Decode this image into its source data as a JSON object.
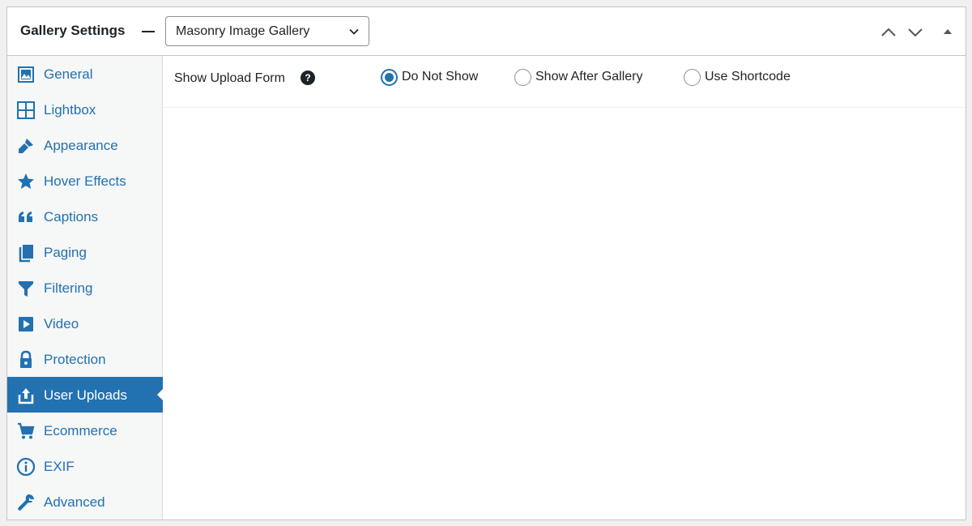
{
  "header": {
    "title": "Gallery Settings",
    "select_value": "Masonry Image Gallery"
  },
  "sidebar": {
    "items": [
      {
        "label": "General",
        "icon": "image-icon",
        "active": false
      },
      {
        "label": "Lightbox",
        "icon": "grid-icon",
        "active": false
      },
      {
        "label": "Appearance",
        "icon": "brush-icon",
        "active": false
      },
      {
        "label": "Hover Effects",
        "icon": "star-icon",
        "active": false
      },
      {
        "label": "Captions",
        "icon": "quote-icon",
        "active": false
      },
      {
        "label": "Paging",
        "icon": "pages-icon",
        "active": false
      },
      {
        "label": "Filtering",
        "icon": "filter-icon",
        "active": false
      },
      {
        "label": "Video",
        "icon": "video-icon",
        "active": false
      },
      {
        "label": "Protection",
        "icon": "lock-icon",
        "active": false
      },
      {
        "label": "User Uploads",
        "icon": "upload-icon",
        "active": true
      },
      {
        "label": "Ecommerce",
        "icon": "cart-icon",
        "active": false
      },
      {
        "label": "EXIF",
        "icon": "info-icon",
        "active": false
      },
      {
        "label": "Advanced",
        "icon": "wrench-icon",
        "active": false
      }
    ]
  },
  "setting": {
    "label": "Show Upload Form",
    "help": "?",
    "options": [
      {
        "label": "Do Not Show",
        "checked": true
      },
      {
        "label": "Show After Gallery",
        "checked": false
      },
      {
        "label": "Use Shortcode",
        "checked": false
      }
    ]
  },
  "colors": {
    "accent": "#2271b1",
    "text": "#1d2327",
    "sidebar_bg": "#f6f7f7"
  }
}
